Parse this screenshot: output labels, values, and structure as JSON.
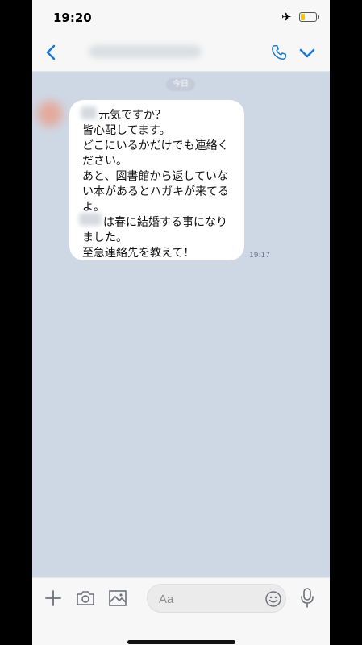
{
  "status_bar": {
    "time": "19:20"
  },
  "chat": {
    "date_label": "今日",
    "message": {
      "lines": [
        "元気ですか？",
        "皆心配してます。",
        "どこにいるかだけでも連絡く",
        "ださい。",
        "あと、図書館から返していな",
        "い本があるとハガキが来てる",
        "よ。",
        "は春に結婚する事になり",
        "ました。",
        "至急連絡先を教えて！"
      ],
      "time": "19:17"
    }
  },
  "input_bar": {
    "placeholder": "Aa"
  },
  "colors": {
    "accent": "#1a7ad9",
    "chat_bg": "#ced8e5",
    "bubble": "#ffffff"
  },
  "icons": [
    "back-chevron-icon",
    "phone-icon",
    "chevron-down-icon",
    "plus-icon",
    "camera-icon",
    "image-icon",
    "smiley-icon",
    "microphone-icon",
    "airplane-icon",
    "battery-icon"
  ]
}
